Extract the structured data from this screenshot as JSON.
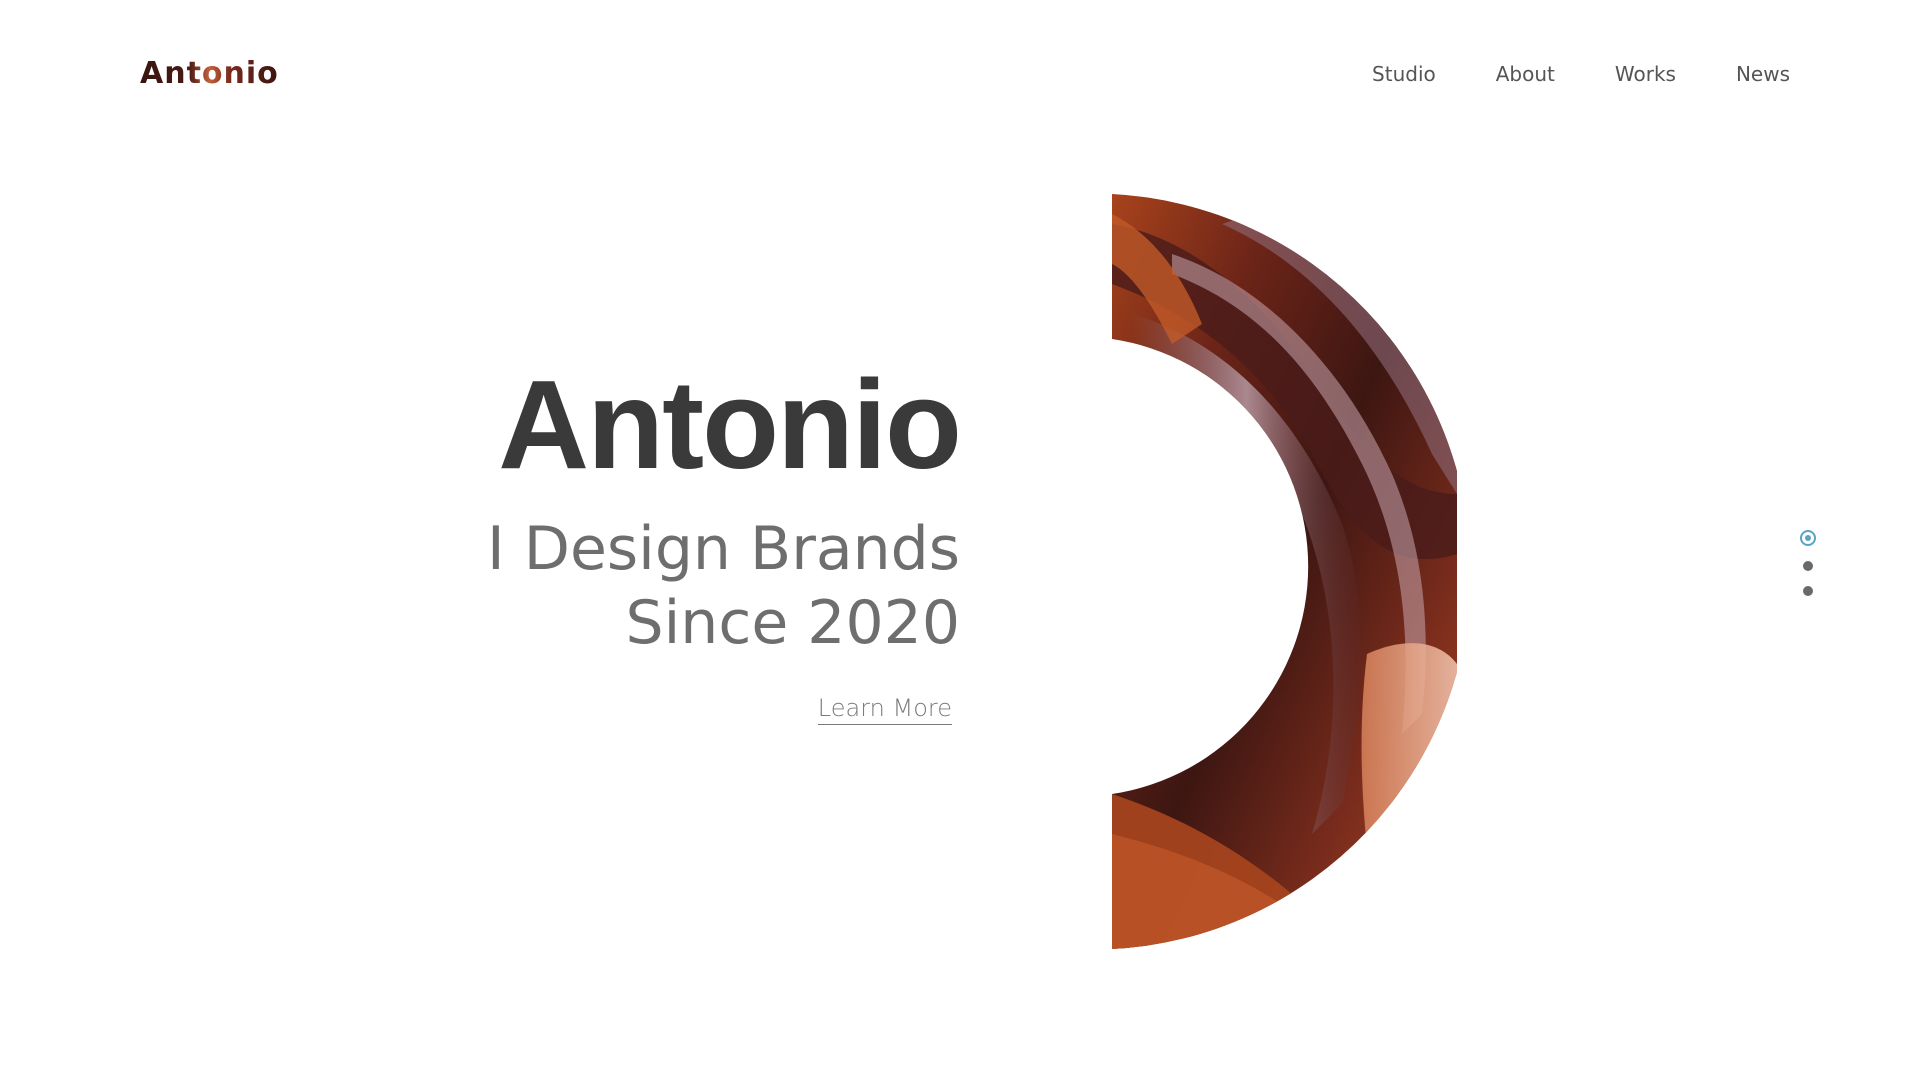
{
  "header": {
    "logo_text": "Antonio",
    "nav": [
      {
        "label": "Studio"
      },
      {
        "label": "About"
      },
      {
        "label": "Works"
      },
      {
        "label": "News"
      }
    ]
  },
  "hero": {
    "title": "Antonio",
    "subtitle_line1": "I Design Brands",
    "subtitle_line2": "Since 2020",
    "cta_label": "Learn More"
  },
  "slider": {
    "total_slides": 3,
    "active_index": 0,
    "active_color": "#5aa3c2"
  },
  "image": {
    "subject": "canyon-rock-photo"
  }
}
